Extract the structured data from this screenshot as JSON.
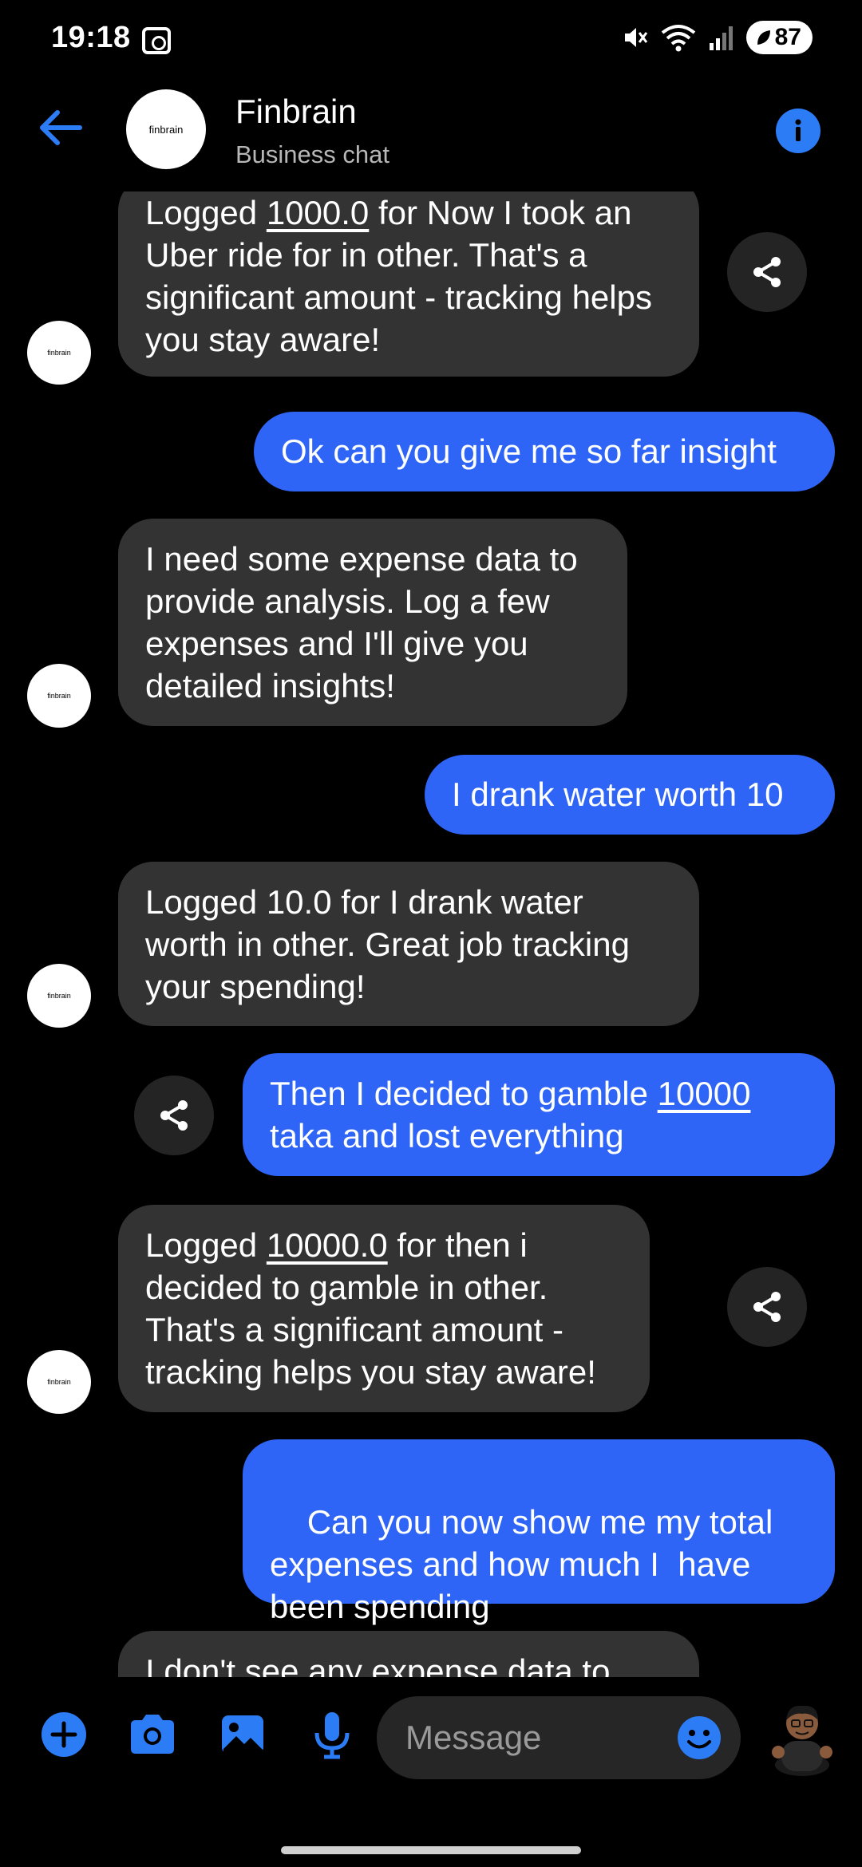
{
  "status_bar": {
    "time": "19:18",
    "battery": "87"
  },
  "header": {
    "name": "Finbrain",
    "subtitle": "Business chat",
    "avatar_text": "finbrain"
  },
  "messages": [
    {
      "from": "bot",
      "parts": [
        {
          "text": "Logged "
        },
        {
          "text": "1000.0",
          "underline": true
        },
        {
          "text": " for Now I took an Uber ride for in other. That's a significant amount - tracking helps you stay aware!"
        }
      ]
    },
    {
      "from": "user",
      "parts": [
        {
          "text": "Ok can you give me so far insight"
        }
      ]
    },
    {
      "from": "bot",
      "parts": [
        {
          "text": "I need some expense data to provide analysis. Log a few expenses and I'll give you detailed insights!"
        }
      ]
    },
    {
      "from": "user",
      "parts": [
        {
          "text": "I drank water worth 10"
        }
      ]
    },
    {
      "from": "bot",
      "parts": [
        {
          "text": "Logged 10.0 for I drank water worth in other. Great job tracking your spending!"
        }
      ]
    },
    {
      "from": "user",
      "parts": [
        {
          "text": "Then I decided to gamble "
        },
        {
          "text": "10000",
          "underline": true
        },
        {
          "text": " taka and lost everything"
        }
      ]
    },
    {
      "from": "bot",
      "parts": [
        {
          "text": "Logged "
        },
        {
          "text": "10000.0",
          "underline": true
        },
        {
          "text": " for then i decided to gamble in other. That's a significant amount - tracking helps you stay aware!"
        }
      ]
    },
    {
      "from": "user",
      "parts": [
        {
          "text": "Can you now show me my total expenses and how much I  have been spending"
        }
      ]
    },
    {
      "from": "bot",
      "parts": [
        {
          "text": "I don't see any expense data to"
        }
      ]
    }
  ],
  "composer": {
    "placeholder": "Message"
  },
  "colors": {
    "accent": "#2c7cf6",
    "user_bubble": "#2f65f6",
    "bot_bubble": "#333333"
  }
}
